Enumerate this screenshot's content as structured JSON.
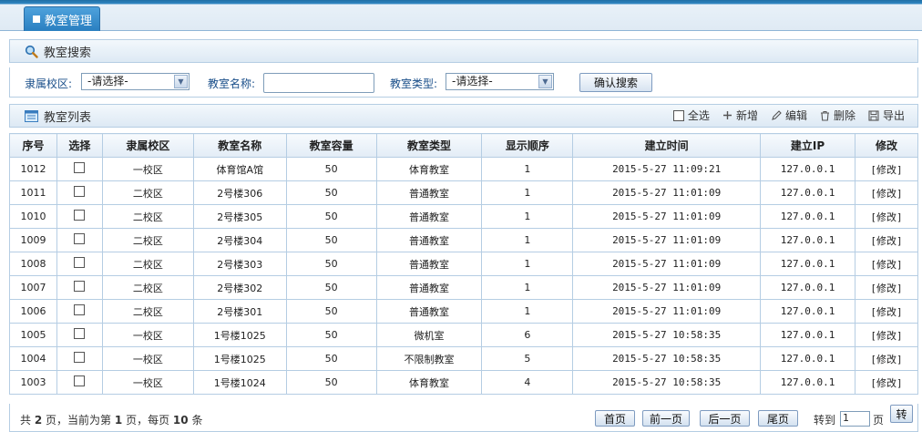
{
  "tab": {
    "label": "教室管理"
  },
  "search_panel": {
    "title": "教室搜索"
  },
  "search_form": {
    "campus_label": "隶属校区:",
    "campus_value": "-请选择-",
    "name_label": "教室名称:",
    "name_value": "",
    "type_label": "教室类型:",
    "type_value": "-请选择-",
    "submit_label": "确认搜索"
  },
  "list_panel": {
    "title": "教室列表"
  },
  "toolbar": {
    "select_all": "全选",
    "add": "新增",
    "edit": "编辑",
    "delete": "删除",
    "export": "导出"
  },
  "table": {
    "headers": [
      "序号",
      "选择",
      "隶属校区",
      "教室名称",
      "教室容量",
      "教室类型",
      "显示顺序",
      "建立时间",
      "建立IP",
      "修改"
    ],
    "rows": [
      {
        "id": "1012",
        "campus": "一校区",
        "name": "体育馆A馆",
        "capacity": "50",
        "type": "体育教室",
        "order": "1",
        "time": "2015-5-27 11:09:21",
        "ip": "127.0.0.1",
        "edit": "[修改]"
      },
      {
        "id": "1011",
        "campus": "二校区",
        "name": "2号楼306",
        "capacity": "50",
        "type": "普通教室",
        "order": "1",
        "time": "2015-5-27 11:01:09",
        "ip": "127.0.0.1",
        "edit": "[修改]"
      },
      {
        "id": "1010",
        "campus": "二校区",
        "name": "2号楼305",
        "capacity": "50",
        "type": "普通教室",
        "order": "1",
        "time": "2015-5-27 11:01:09",
        "ip": "127.0.0.1",
        "edit": "[修改]"
      },
      {
        "id": "1009",
        "campus": "二校区",
        "name": "2号楼304",
        "capacity": "50",
        "type": "普通教室",
        "order": "1",
        "time": "2015-5-27 11:01:09",
        "ip": "127.0.0.1",
        "edit": "[修改]"
      },
      {
        "id": "1008",
        "campus": "二校区",
        "name": "2号楼303",
        "capacity": "50",
        "type": "普通教室",
        "order": "1",
        "time": "2015-5-27 11:01:09",
        "ip": "127.0.0.1",
        "edit": "[修改]"
      },
      {
        "id": "1007",
        "campus": "二校区",
        "name": "2号楼302",
        "capacity": "50",
        "type": "普通教室",
        "order": "1",
        "time": "2015-5-27 11:01:09",
        "ip": "127.0.0.1",
        "edit": "[修改]"
      },
      {
        "id": "1006",
        "campus": "二校区",
        "name": "2号楼301",
        "capacity": "50",
        "type": "普通教室",
        "order": "1",
        "time": "2015-5-27 11:01:09",
        "ip": "127.0.0.1",
        "edit": "[修改]"
      },
      {
        "id": "1005",
        "campus": "一校区",
        "name": "1号楼1025",
        "capacity": "50",
        "type": "微机室",
        "order": "6",
        "time": "2015-5-27 10:58:35",
        "ip": "127.0.0.1",
        "edit": "[修改]"
      },
      {
        "id": "1004",
        "campus": "一校区",
        "name": "1号楼1025",
        "capacity": "50",
        "type": "不限制教室",
        "order": "5",
        "time": "2015-5-27 10:58:35",
        "ip": "127.0.0.1",
        "edit": "[修改]"
      },
      {
        "id": "1003",
        "campus": "一校区",
        "name": "1号楼1024",
        "capacity": "50",
        "type": "体育教室",
        "order": "4",
        "time": "2015-5-27 10:58:35",
        "ip": "127.0.0.1",
        "edit": "[修改]"
      }
    ]
  },
  "pager": {
    "info_prefix": "共",
    "total_pages": "2",
    "info_mid1": "页，当前为第",
    "current_page": "1",
    "info_mid2": "页，每页",
    "per_page": "10",
    "info_suffix": "条",
    "first": "首页",
    "prev": "前一页",
    "next": "后一页",
    "last": "尾页",
    "goto_label": "转到",
    "goto_value": "1",
    "page_unit": "页",
    "go": "转"
  }
}
